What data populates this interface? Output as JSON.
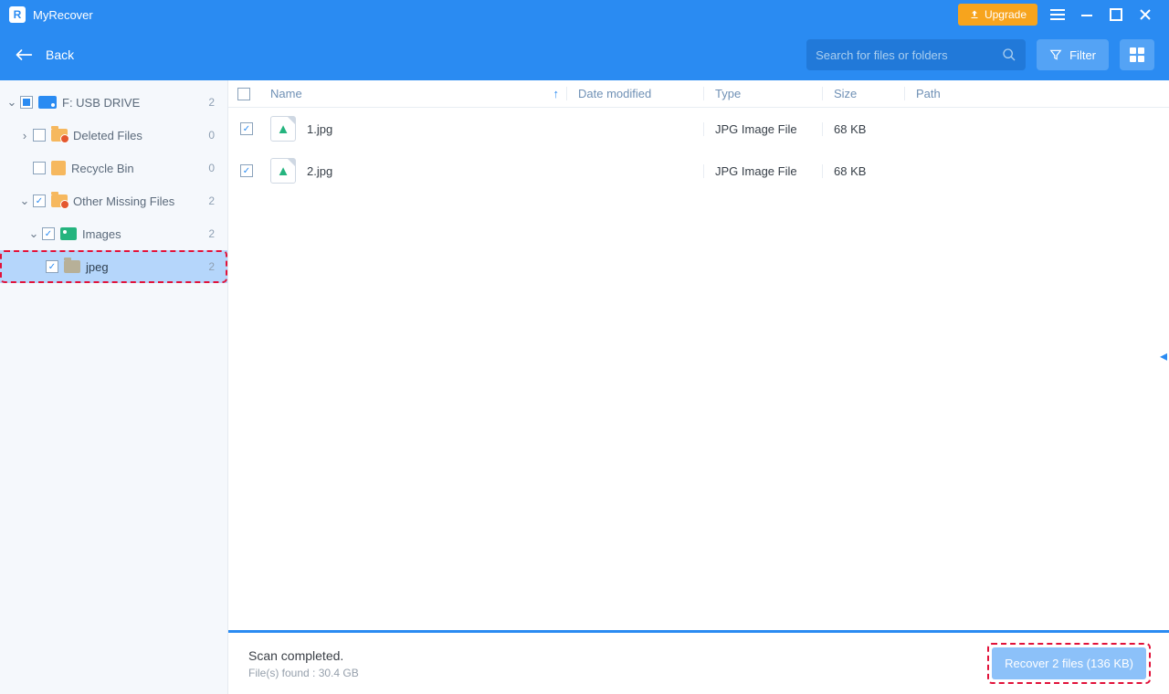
{
  "app": {
    "title": "MyRecover",
    "upgrade": "Upgrade"
  },
  "toolbar": {
    "back": "Back",
    "search_placeholder": "Search for files or folders",
    "filter": "Filter"
  },
  "sidebar": {
    "drive": {
      "label": "F: USB DRIVE",
      "count": "2"
    },
    "deleted": {
      "label": "Deleted Files",
      "count": "0"
    },
    "recycle": {
      "label": "Recycle Bin",
      "count": "0"
    },
    "missing": {
      "label": "Other Missing Files",
      "count": "2"
    },
    "images": {
      "label": "Images",
      "count": "2"
    },
    "jpeg": {
      "label": "jpeg",
      "count": "2"
    }
  },
  "columns": {
    "name": "Name",
    "date": "Date modified",
    "type": "Type",
    "size": "Size",
    "path": "Path"
  },
  "files": [
    {
      "name": "1.jpg",
      "date": "",
      "type": "JPG Image File",
      "size": "68 KB",
      "path": ""
    },
    {
      "name": "2.jpg",
      "date": "",
      "type": "JPG Image File",
      "size": "68 KB",
      "path": ""
    }
  ],
  "footer": {
    "status": "Scan completed.",
    "sub": "File(s) found : 30.4 GB",
    "recover": "Recover 2 files (136 KB)"
  }
}
